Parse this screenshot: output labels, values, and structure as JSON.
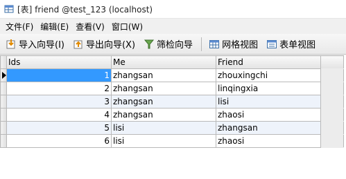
{
  "window": {
    "title": "[表] friend @test_123 (localhost)"
  },
  "menu": {
    "items": [
      "文件(F)",
      "编辑(E)",
      "查看(V)",
      "窗口(W)"
    ]
  },
  "toolbar": {
    "import_label": "导入向导(I)",
    "export_label": "导出向导(X)",
    "filter_label": "筛检向导",
    "grid_view_label": "网格视图",
    "form_view_label": "表单视图"
  },
  "table": {
    "columns": [
      "Ids",
      "Me",
      "Friend"
    ],
    "rows": [
      {
        "ids": "1",
        "me": "zhangsan",
        "friend": "zhouxingchi"
      },
      {
        "ids": "2",
        "me": "zhangsan",
        "friend": "linqingxia"
      },
      {
        "ids": "3",
        "me": "zhangsan",
        "friend": "lisi"
      },
      {
        "ids": "4",
        "me": "zhangsan",
        "friend": "zhaosi"
      },
      {
        "ids": "5",
        "me": "lisi",
        "friend": "zhangsan"
      },
      {
        "ids": "6",
        "me": "lisi",
        "friend": "zhaosi"
      }
    ],
    "selected_row": 0
  }
}
